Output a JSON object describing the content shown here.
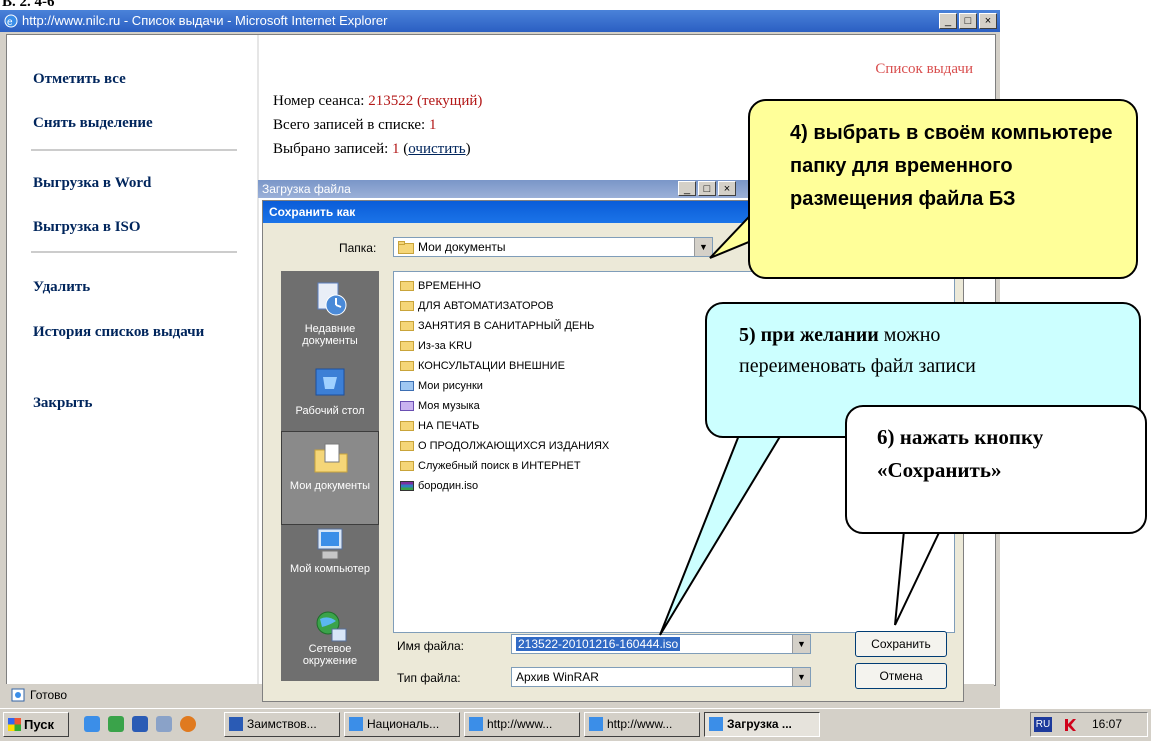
{
  "caption": "В. 2. 4-6",
  "window": {
    "title": "http://www.nilc.ru - Список выдачи - Microsoft Internet Explorer",
    "minimize": "_",
    "maximize": "□",
    "close": "×"
  },
  "sidebar": {
    "items": [
      {
        "label": "Отметить все"
      },
      {
        "label": "Снять выделение"
      },
      {
        "label": "Выгрузка в Word"
      },
      {
        "label": "Выгрузка в ISO"
      },
      {
        "label": "Удалить"
      },
      {
        "label": "История списков выдачи"
      },
      {
        "label": "Закрыть"
      }
    ]
  },
  "main": {
    "list_title": "Список выдачи",
    "session_label": "Номер сеанса:",
    "session_value": "213522 (текущий)",
    "total_label": "Всего записей в списке:",
    "total_value": "1",
    "selected_label": "Выбрано записей:",
    "selected_value": "1",
    "clear_link": "очистить"
  },
  "status_bar": {
    "text": "Готово"
  },
  "download_dialog": {
    "title": "Загрузка файла"
  },
  "save_dialog": {
    "title": "Сохранить как",
    "folder_label": "Папка:",
    "folder_value": "Мои документы",
    "places": [
      {
        "label": "Недавние документы",
        "icon": "recent-documents-icon"
      },
      {
        "label": "Рабочий стол",
        "icon": "desktop-icon"
      },
      {
        "label": "Мои документы",
        "icon": "my-documents-icon"
      },
      {
        "label": "Мой компьютер",
        "icon": "my-computer-icon"
      },
      {
        "label": "Сетевое окружение",
        "icon": "network-icon"
      }
    ],
    "files": [
      {
        "name": "ВРЕМЕННО",
        "kind": "folder"
      },
      {
        "name": "ДЛЯ АВТОМАТИЗАТОРОВ",
        "kind": "folder"
      },
      {
        "name": "ЗАНЯТИЯ В САНИТАРНЫЙ ДЕНЬ",
        "kind": "folder"
      },
      {
        "name": "Из-за KRU",
        "kind": "folder"
      },
      {
        "name": "КОНСУЛЬТАЦИИ ВНЕШНИЕ",
        "kind": "folder"
      },
      {
        "name": "Мои рисунки",
        "kind": "special"
      },
      {
        "name": "Моя музыка",
        "kind": "special"
      },
      {
        "name": "НА ПЕЧАТЬ",
        "kind": "folder"
      },
      {
        "name": "О ПРОДОЛЖАЮЩИХСЯ ИЗДАНИЯХ",
        "kind": "folder"
      },
      {
        "name": "Служебный поиск в ИНТЕРНЕТ",
        "kind": "folder"
      },
      {
        "name": "бородин.iso",
        "kind": "archive"
      }
    ],
    "filename_label": "Имя файла:",
    "filename_value": "213522-20101216-160444.iso",
    "filetype_label": "Тип файла:",
    "filetype_value": "Архив WinRAR",
    "save_button": "Сохранить",
    "cancel_button": "Отмена"
  },
  "callouts": {
    "c4": "4) выбрать в своём компьютере папку для временного размещения файла БЗ",
    "c5_bold": "5) при желании",
    "c5_rest": "можно переименовать файл записи",
    "c6": "6) нажать кнопку «Сохранить»"
  },
  "taskbar": {
    "start": "Пуск",
    "buttons": [
      {
        "label": "Заимствов..."
      },
      {
        "label": "Националь..."
      },
      {
        "label": "http://www..."
      },
      {
        "label": "http://www..."
      },
      {
        "label": "Загрузка ..."
      }
    ],
    "lang": "RU",
    "clock": "16:07"
  },
  "colors": {
    "accent_title": "#2b5fc2",
    "link": "#00255c",
    "callout_yellow": "#ffff99",
    "callout_cyan": "#ccffff"
  }
}
